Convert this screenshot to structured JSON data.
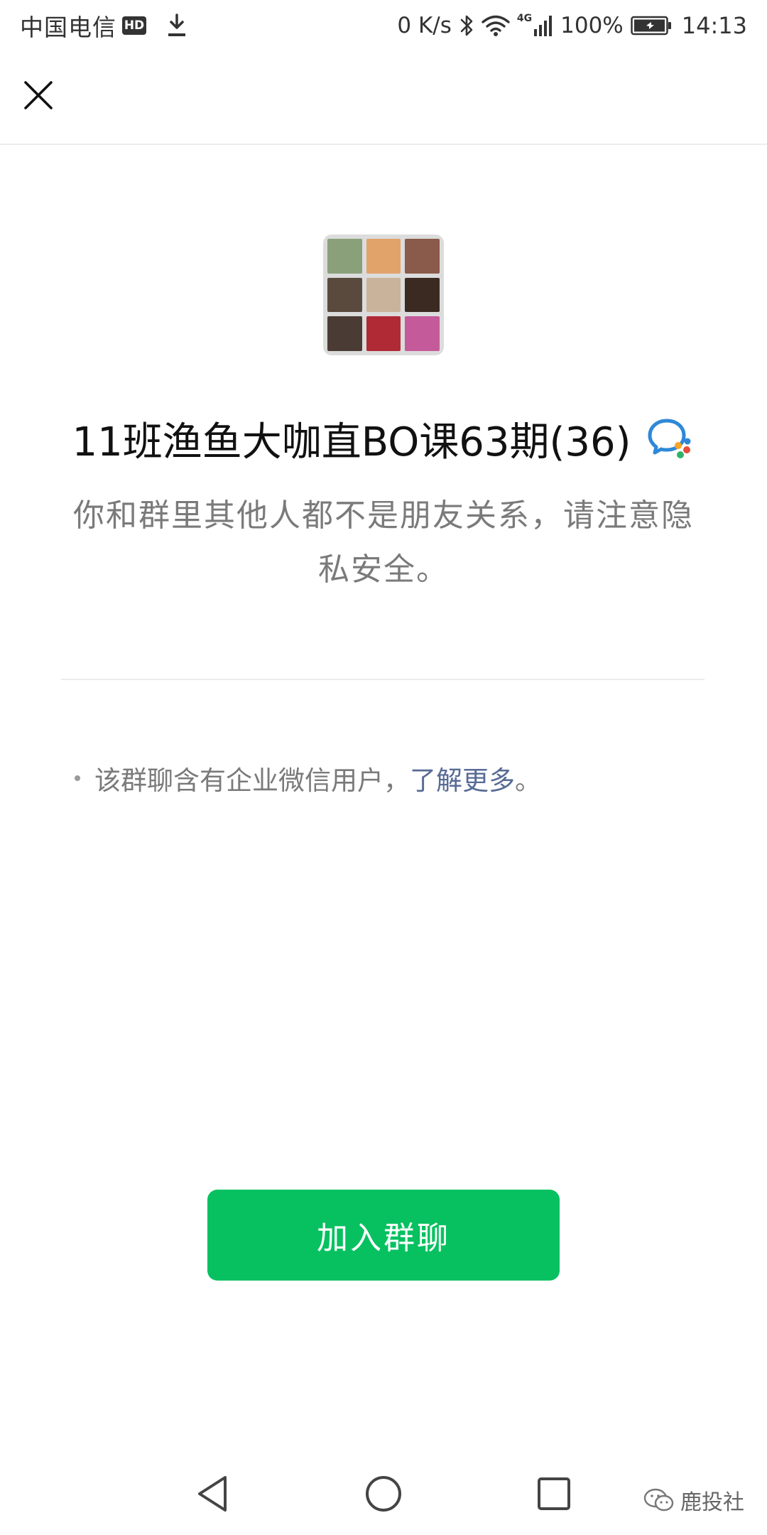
{
  "status_bar": {
    "carrier": "中国电信",
    "hd_badge": "HD",
    "net_speed": "0 K/s",
    "network_type": "4G",
    "battery_percent": "100%",
    "time": "14:13",
    "icons": [
      "download-icon",
      "bluetooth-icon",
      "wifi-icon",
      "signal-icon",
      "battery-icon"
    ]
  },
  "nav": {
    "close_icon": "close-icon"
  },
  "group": {
    "name": "11班渔鱼大咖直BO课63期(36)",
    "badge_icon": "wecom-icon",
    "avatar_tiles": [
      "#8aa07a",
      "#e2a36b",
      "#8a5a4a",
      "#5a4a3e",
      "#c9b39a",
      "#3a2a22",
      "#4a3c34",
      "#b02a35",
      "#c45a9a"
    ],
    "privacy_note": "你和群里其他人都不是朋友关系，请注意隐私安全。",
    "info_text": "该群聊含有企业微信用户，",
    "info_link": "了解更多",
    "info_suffix": "。"
  },
  "actions": {
    "join_label": "加入群聊"
  },
  "system_nav": {
    "icons": [
      "back-icon",
      "home-icon",
      "recents-icon"
    ]
  },
  "watermark": {
    "text": "鹿投社"
  },
  "colors": {
    "accent": "#07c160",
    "link": "#576b95",
    "secondary_text": "#7a7a7a"
  }
}
